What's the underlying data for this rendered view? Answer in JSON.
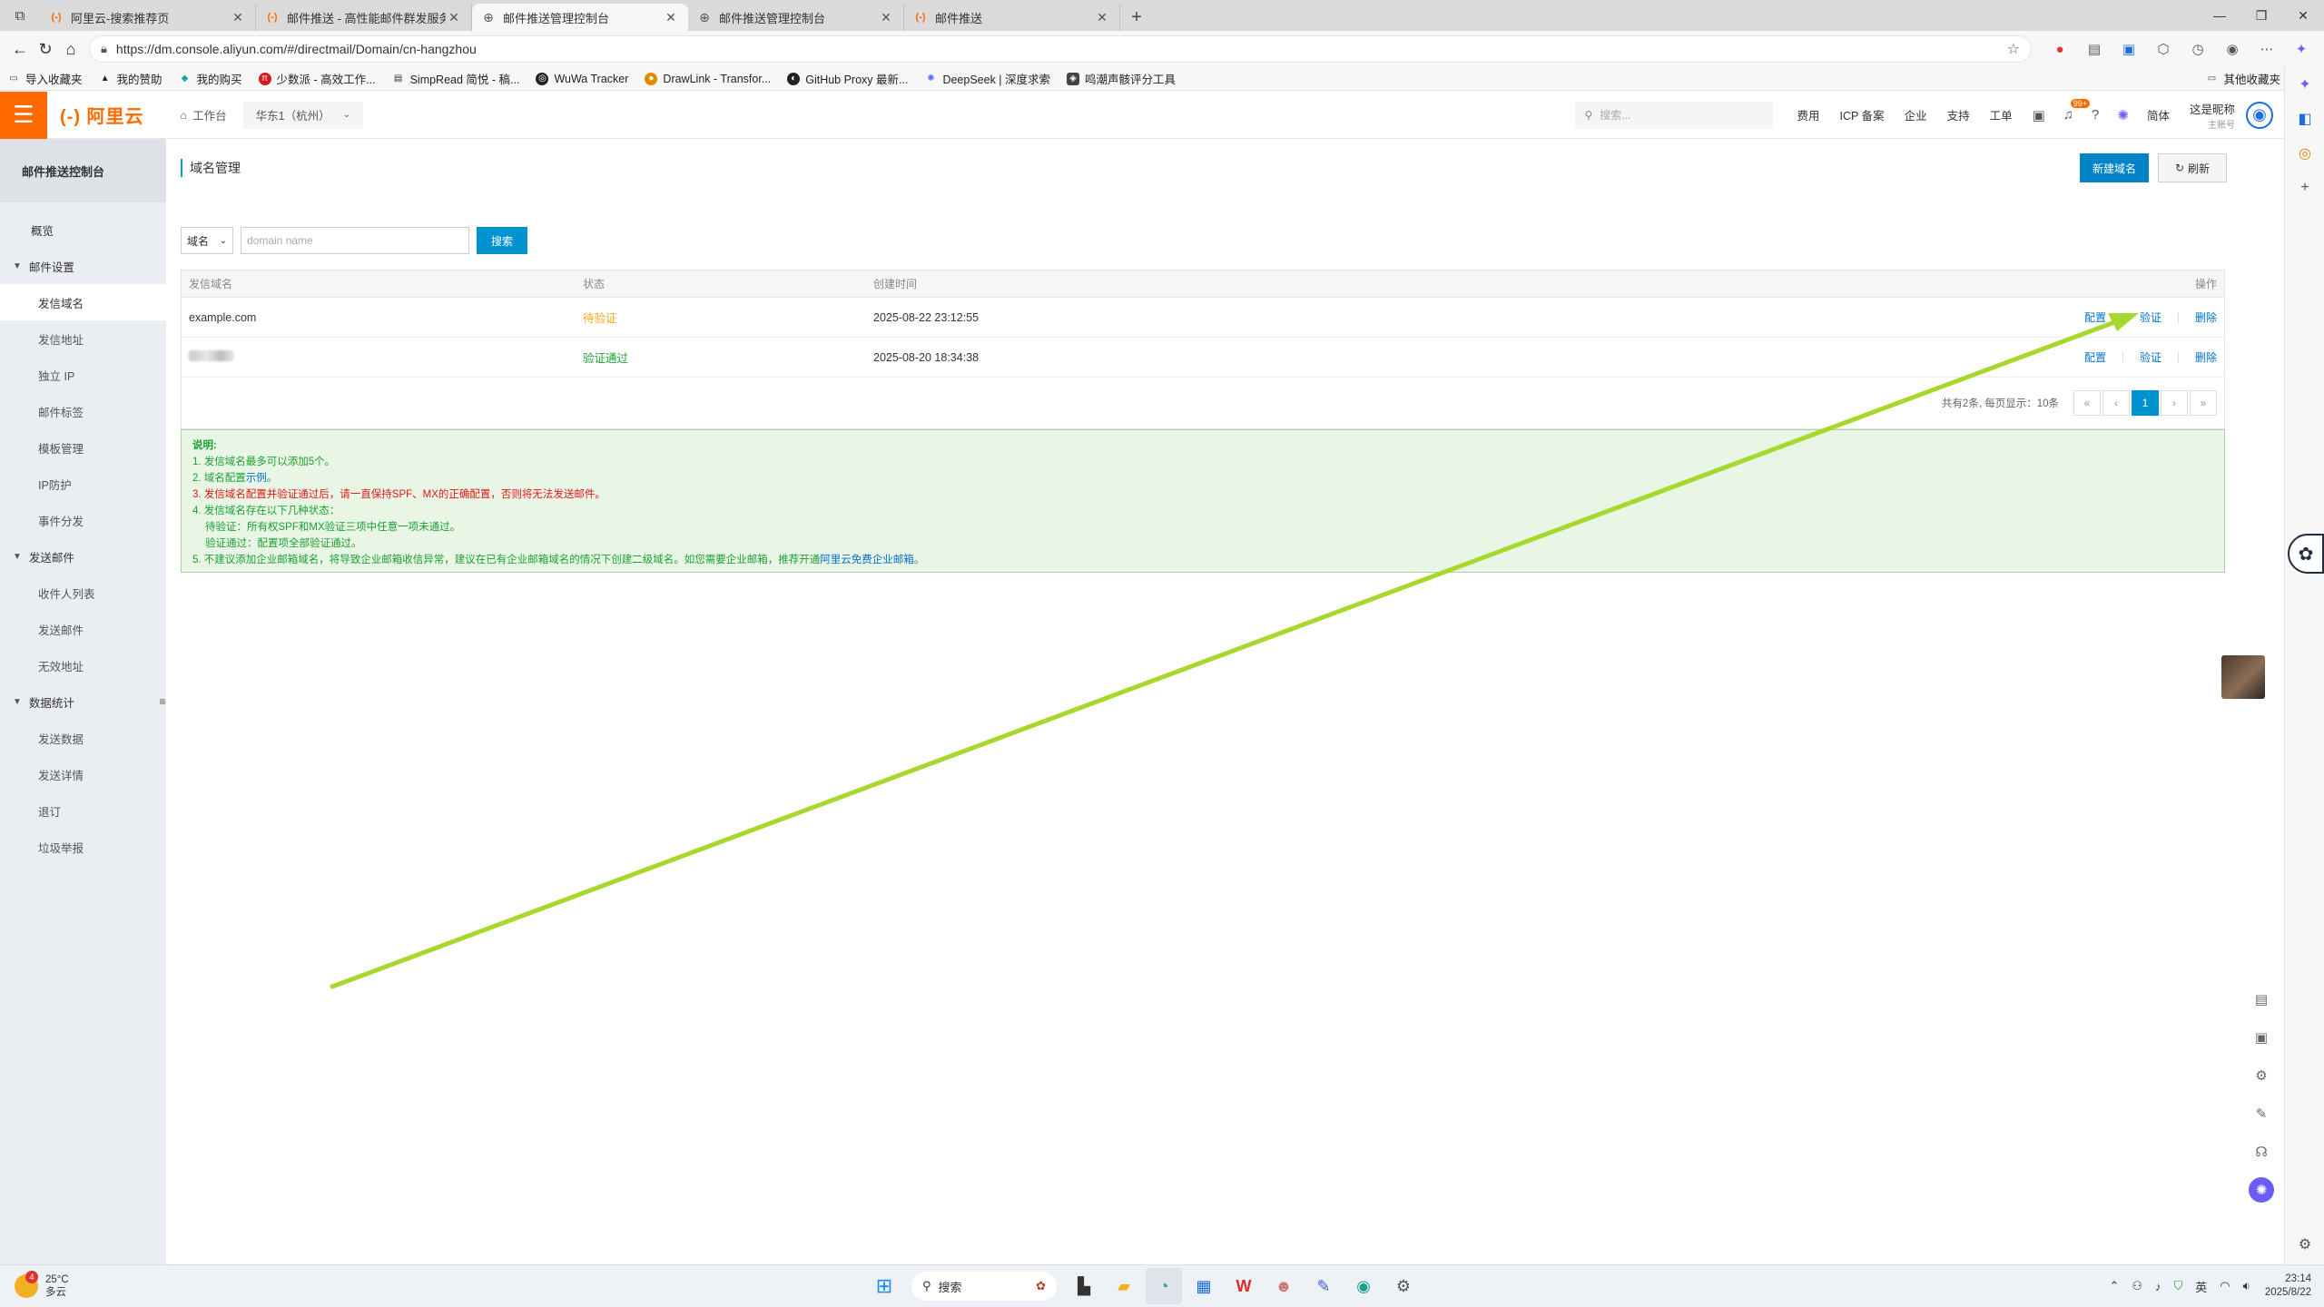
{
  "browser": {
    "tabs": [
      {
        "label": "阿里云-搜索推荐页",
        "favicon": "aliyun"
      },
      {
        "label": "邮件推送 - 高性能邮件群发服务 -",
        "favicon": "aliyun"
      },
      {
        "label": "邮件推送管理控制台",
        "favicon": "globe",
        "active": true
      },
      {
        "label": "邮件推送管理控制台",
        "favicon": "globe"
      },
      {
        "label": "邮件推送",
        "favicon": "aliyun"
      }
    ],
    "url": "https://dm.console.aliyun.com/#/directmail/Domain/cn-hangzhou",
    "bookmarks": [
      {
        "label": "导入收藏夹"
      },
      {
        "label": "我的赞助"
      },
      {
        "label": "我的购买"
      },
      {
        "label": "少数派 - 高效工作..."
      },
      {
        "label": "SimpRead 简悦 - 稿..."
      },
      {
        "label": "WuWa Tracker"
      },
      {
        "label": "DrawLink - Transfor..."
      },
      {
        "label": "GitHub Proxy 最新..."
      },
      {
        "label": "DeepSeek | 深度求索"
      },
      {
        "label": "鸣潮声骸评分工具"
      }
    ],
    "other_bookmarks": "其他收藏夹"
  },
  "topnav": {
    "logo": "(-) 阿里云",
    "workbench": "工作台",
    "region": "华东1（杭州）",
    "search_placeholder": "搜索...",
    "links": [
      "费用",
      "ICP 备案",
      "企业",
      "支持",
      "工单"
    ],
    "notification_badge": "99+",
    "lang": "简体",
    "account_name": "这是昵称",
    "account_type": "主账号"
  },
  "sidebar": {
    "title": "邮件推送控制台",
    "overview": "概览",
    "groups": [
      {
        "label": "邮件设置",
        "items": [
          "发信域名",
          "发信地址",
          "独立 IP",
          "邮件标签",
          "模板管理",
          "IP防护",
          "事件分发"
        ]
      },
      {
        "label": "发送邮件",
        "items": [
          "收件人列表",
          "发送邮件",
          "无效地址"
        ]
      },
      {
        "label": "数据统计",
        "items": [
          "发送数据",
          "发送详情",
          "退订",
          "垃圾举报"
        ]
      }
    ],
    "active_item": "发信域名"
  },
  "page": {
    "title": "域名管理",
    "new_button": "新建域名",
    "refresh_button": "刷新",
    "filter_select": "域名",
    "search_placeholder": "domain name",
    "search_button": "搜索",
    "columns": [
      "发信域名",
      "状态",
      "创建时间",
      "操作"
    ],
    "rows": [
      {
        "domain": "example.com",
        "status": "待验证",
        "status_kind": "pending",
        "created": "2025-08-22 23:12:55",
        "ops": [
          "配置",
          "验证",
          "删除"
        ]
      },
      {
        "domain": "",
        "status": "验证通过",
        "status_kind": "ok",
        "created": "2025-08-20 18:34:38",
        "ops": [
          "配置",
          "验证",
          "删除"
        ]
      }
    ],
    "pager": {
      "summary": "共有2条, 每页显示：10条",
      "first": "«",
      "prev": "‹",
      "current": "1",
      "next": "›",
      "last": "»"
    },
    "notes": {
      "title": "说明:",
      "l1": "1. 发信域名最多可以添加5个。",
      "l2_prefix": "2. 域名配置",
      "l2_link": "示例",
      "l2_suffix": "。",
      "l3": "3. 发信域名配置并验证通过后，请一直保持SPF、MX的正确配置，否则将无法发送邮件。",
      "l4": "4. 发信域名存在以下几种状态：",
      "l4a": "待验证：所有权SPF和MX验证三项中任意一项未通过。",
      "l4b": "验证通过：配置项全部验证通过。",
      "l5_prefix": "5. 不建议添加企业邮箱域名，将导致企业邮箱收信异常，建议在已有企业邮箱域名的情况下创建二级域名。如您需要企业邮箱，推荐开通",
      "l5_link": "阿里云免费企业邮箱",
      "l5_suffix": "。"
    }
  },
  "annotation": {
    "color": "#a6d92b"
  },
  "taskbar": {
    "weather_temp": "25°C",
    "weather_desc": "多云",
    "weather_badge": "4",
    "search": "搜索",
    "ime": "英",
    "time": "23:14",
    "date": "2025/8/22"
  }
}
